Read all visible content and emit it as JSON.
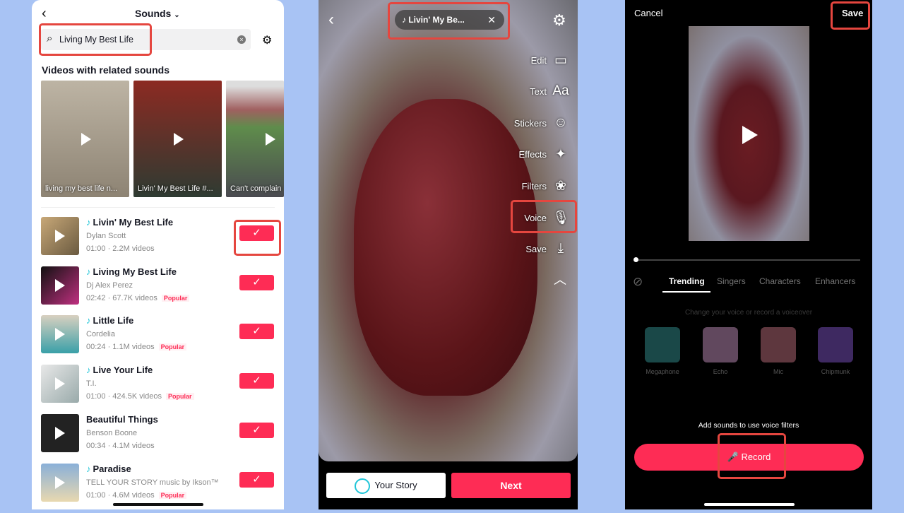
{
  "sounds": {
    "title": "Sounds",
    "search_value": "Living My Best Life",
    "section": "Videos with related sounds",
    "videos": [
      {
        "caption": "living my best life n..."
      },
      {
        "caption": "Livin' My Best Life #..."
      },
      {
        "caption": "Can't complain"
      }
    ],
    "items": [
      {
        "title": "Livin' My Best Life",
        "artist": "Dylan Scott",
        "meta": "01:00 · 2.2M videos",
        "badge": "",
        "note": true
      },
      {
        "title": "Living My Best Life",
        "artist": "Dj Alex Perez",
        "meta": "02:42 · 67.7K videos",
        "badge": "Popular",
        "note": true
      },
      {
        "title": "Little Life",
        "artist": "Cordelia",
        "meta": "00:24 · 1.1M videos",
        "badge": "Popular",
        "note": true
      },
      {
        "title": "Live Your Life",
        "artist": "T.I.",
        "meta": "01:00 · 424.5K videos",
        "badge": "Popular",
        "note": true
      },
      {
        "title": "Beautiful Things",
        "artist": "Benson Boone",
        "meta": "00:34 · 4.1M videos",
        "badge": "",
        "note": false
      },
      {
        "title": "Paradise",
        "artist": "TELL YOUR STORY music by Ikson™",
        "meta": "01:00 · 4.6M videos",
        "badge": "Popular",
        "note": true
      }
    ],
    "check": "✓"
  },
  "editor": {
    "sound_pill": "Livin' My Be...",
    "tools": [
      "Edit",
      "Text",
      "Stickers",
      "Effects",
      "Filters",
      "Voice",
      "Save"
    ],
    "your_story": "Your Story",
    "next": "Next"
  },
  "voice": {
    "cancel": "Cancel",
    "save": "Save",
    "tabs": [
      "Trending",
      "Singers",
      "Characters",
      "Enhancers"
    ],
    "active_tab": "Trending",
    "hint": "Change your voice or record a voiceover",
    "filters": [
      "Megaphone",
      "Echo",
      "Mic",
      "Chipmunk"
    ],
    "notice": "Add sounds to use voice filters",
    "record": "Record"
  },
  "colors": {
    "accent": "#fe2c55",
    "highlight": "#e5463f",
    "background": "#a8c3f4"
  }
}
